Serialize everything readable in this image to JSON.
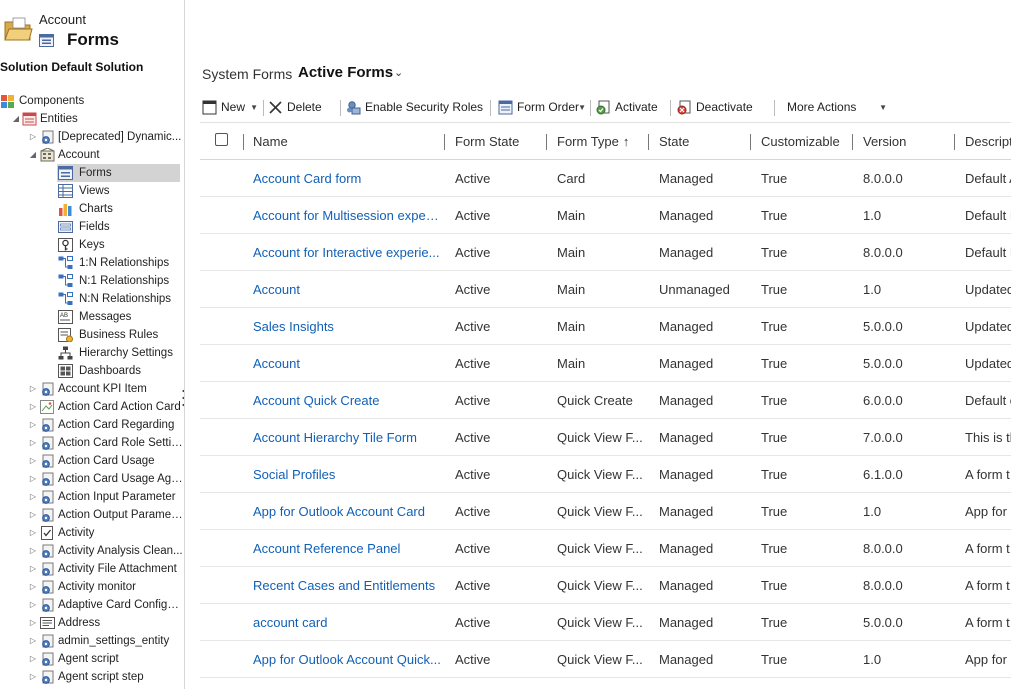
{
  "header": {
    "entity": "Account",
    "title": "Forms",
    "solution_label": "Solution Default Solution"
  },
  "tree": [
    {
      "label": "Components",
      "level": 0,
      "toggle": "",
      "icon": "components-icon",
      "selected": false
    },
    {
      "label": "Entities",
      "level": 1,
      "toggle": "◢",
      "icon": "entities-icon",
      "selected": false
    },
    {
      "label": "[Deprecated] Dynamic...",
      "level": 2,
      "toggle": "▷",
      "icon": "entity-gear-icon",
      "selected": false
    },
    {
      "label": "Account",
      "level": 2,
      "toggle": "◢",
      "icon": "account-entity-icon",
      "selected": false
    },
    {
      "label": "Forms",
      "level": 3,
      "toggle": "",
      "icon": "forms-icon",
      "selected": true
    },
    {
      "label": "Views",
      "level": 3,
      "toggle": "",
      "icon": "views-icon",
      "selected": false
    },
    {
      "label": "Charts",
      "level": 3,
      "toggle": "",
      "icon": "charts-icon",
      "selected": false
    },
    {
      "label": "Fields",
      "level": 3,
      "toggle": "",
      "icon": "fields-icon",
      "selected": false
    },
    {
      "label": "Keys",
      "level": 3,
      "toggle": "",
      "icon": "keys-icon",
      "selected": false
    },
    {
      "label": "1:N Relationships",
      "level": 3,
      "toggle": "",
      "icon": "relationship-icon",
      "selected": false
    },
    {
      "label": "N:1 Relationships",
      "level": 3,
      "toggle": "",
      "icon": "relationship-icon",
      "selected": false
    },
    {
      "label": "N:N Relationships",
      "level": 3,
      "toggle": "",
      "icon": "relationship-icon",
      "selected": false
    },
    {
      "label": "Messages",
      "level": 3,
      "toggle": "",
      "icon": "messages-icon",
      "selected": false
    },
    {
      "label": "Business Rules",
      "level": 3,
      "toggle": "",
      "icon": "business-rules-icon",
      "selected": false
    },
    {
      "label": "Hierarchy Settings",
      "level": 3,
      "toggle": "",
      "icon": "hierarchy-icon",
      "selected": false
    },
    {
      "label": "Dashboards",
      "level": 3,
      "toggle": "",
      "icon": "dashboards-icon",
      "selected": false
    },
    {
      "label": "Account KPI Item",
      "level": 2,
      "toggle": "▷",
      "icon": "entity-gear-icon",
      "selected": false
    },
    {
      "label": "Action Card Action Card",
      "level": 2,
      "toggle": "▷",
      "icon": "broken-image-icon",
      "selected": false
    },
    {
      "label": "Action Card Regarding",
      "level": 2,
      "toggle": "▷",
      "icon": "entity-gear-icon",
      "selected": false
    },
    {
      "label": "Action Card Role Setting",
      "level": 2,
      "toggle": "▷",
      "icon": "entity-gear-icon",
      "selected": false
    },
    {
      "label": "Action Card Usage",
      "level": 2,
      "toggle": "▷",
      "icon": "entity-gear-icon",
      "selected": false
    },
    {
      "label": "Action Card Usage Agg...",
      "level": 2,
      "toggle": "▷",
      "icon": "entity-gear-icon",
      "selected": false
    },
    {
      "label": "Action Input Parameter",
      "level": 2,
      "toggle": "▷",
      "icon": "entity-gear-icon",
      "selected": false
    },
    {
      "label": "Action Output Parameter",
      "level": 2,
      "toggle": "▷",
      "icon": "entity-gear-icon",
      "selected": false
    },
    {
      "label": "Activity",
      "level": 2,
      "toggle": "▷",
      "icon": "activity-icon",
      "selected": false
    },
    {
      "label": "Activity Analysis Clean...",
      "level": 2,
      "toggle": "▷",
      "icon": "entity-gear-icon",
      "selected": false
    },
    {
      "label": "Activity File Attachment",
      "level": 2,
      "toggle": "▷",
      "icon": "entity-gear-icon",
      "selected": false
    },
    {
      "label": "Activity monitor",
      "level": 2,
      "toggle": "▷",
      "icon": "entity-gear-icon",
      "selected": false
    },
    {
      "label": "Adaptive Card Configur...",
      "level": 2,
      "toggle": "▷",
      "icon": "entity-gear-icon",
      "selected": false
    },
    {
      "label": "Address",
      "level": 2,
      "toggle": "▷",
      "icon": "address-icon",
      "selected": false
    },
    {
      "label": "admin_settings_entity",
      "level": 2,
      "toggle": "▷",
      "icon": "entity-gear-icon",
      "selected": false
    },
    {
      "label": "Agent script",
      "level": 2,
      "toggle": "▷",
      "icon": "entity-gear-icon",
      "selected": false
    },
    {
      "label": "Agent script step",
      "level": 2,
      "toggle": "▷",
      "icon": "entity-gear-icon",
      "selected": false
    }
  ],
  "view": {
    "prefix": "System Forms",
    "name": "Active Forms"
  },
  "toolbar": [
    {
      "label": "New",
      "icon": "new-icon",
      "dropdown": true
    },
    {
      "label": "Delete",
      "icon": "delete-icon",
      "dropdown": false
    },
    {
      "label": "Enable Security Roles",
      "icon": "security-roles-icon",
      "dropdown": false
    },
    {
      "label": "Form Order",
      "icon": "form-order-icon",
      "dropdown": true
    },
    {
      "label": "Activate",
      "icon": "activate-icon",
      "dropdown": false
    },
    {
      "label": "Deactivate",
      "icon": "deactivate-icon",
      "dropdown": false
    },
    {
      "label": "More Actions",
      "icon": "",
      "dropdown": true
    }
  ],
  "grid": {
    "columns": [
      "Name",
      "Form State",
      "Form Type",
      "State",
      "Customizable",
      "Version",
      "Descript"
    ],
    "sort_indicator": "↑",
    "rows": [
      [
        "Account Card form",
        "Active",
        "Card",
        "Managed",
        "True",
        "8.0.0.0",
        "Default A"
      ],
      [
        "Account for Multisession experi...",
        "Active",
        "Main",
        "Managed",
        "True",
        "1.0",
        "Default I"
      ],
      [
        "Account for Interactive experie...",
        "Active",
        "Main",
        "Managed",
        "True",
        "8.0.0.0",
        "Default I"
      ],
      [
        "Account",
        "Active",
        "Main",
        "Unmanaged",
        "True",
        "1.0",
        "Updated"
      ],
      [
        "Sales Insights",
        "Active",
        "Main",
        "Managed",
        "True",
        "5.0.0.0",
        "Updated"
      ],
      [
        "Account",
        "Active",
        "Main",
        "Managed",
        "True",
        "5.0.0.0",
        "Updated"
      ],
      [
        "Account Quick Create",
        "Active",
        "Quick Create",
        "Managed",
        "True",
        "6.0.0.0",
        "Default o"
      ],
      [
        "Account Hierarchy Tile Form",
        "Active",
        "Quick View F...",
        "Managed",
        "True",
        "7.0.0.0",
        "This is th"
      ],
      [
        "Social Profiles",
        "Active",
        "Quick View F...",
        "Managed",
        "True",
        "6.1.0.0",
        "A form t"
      ],
      [
        "App for Outlook Account Card",
        "Active",
        "Quick View F...",
        "Managed",
        "True",
        "1.0",
        "App for"
      ],
      [
        "Account Reference Panel",
        "Active",
        "Quick View F...",
        "Managed",
        "True",
        "8.0.0.0",
        "A form t"
      ],
      [
        "Recent Cases and Entitlements",
        "Active",
        "Quick View F...",
        "Managed",
        "True",
        "8.0.0.0",
        "A form t"
      ],
      [
        "account card",
        "Active",
        "Quick View F...",
        "Managed",
        "True",
        "5.0.0.0",
        "A form t"
      ],
      [
        "App for Outlook Account Quick...",
        "Active",
        "Quick View F...",
        "Managed",
        "True",
        "1.0",
        "App for"
      ]
    ]
  },
  "colors": {
    "link": "#1160b7",
    "selected_bg": "#d3d3d3",
    "text": "#333333"
  }
}
